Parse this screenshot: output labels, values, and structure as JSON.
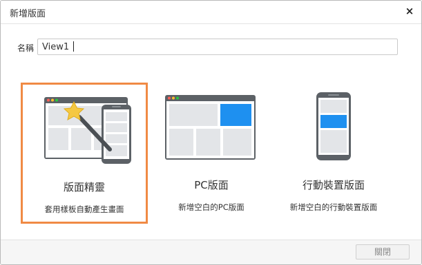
{
  "dialog": {
    "title": "新增版面",
    "close_icon": "×"
  },
  "name_field": {
    "label": "名稱",
    "value": "View1"
  },
  "options": [
    {
      "icon": "wizard-illustration",
      "title": "版面精靈",
      "description": "套用樣板自動產生畫面",
      "selected": true
    },
    {
      "icon": "pc-layout-illustration",
      "title": "PC版面",
      "description": "新增空白的PC版面",
      "selected": false
    },
    {
      "icon": "mobile-layout-illustration",
      "title": "行動裝置版面",
      "description": "新增空白的行動裝置版面",
      "selected": false
    }
  ],
  "footer": {
    "close_label": "關閉"
  },
  "colors": {
    "selection_border": "#f08a44",
    "accent_block": "#1e90f0",
    "frame": "#5c6166",
    "panel": "#e3e5e8"
  }
}
